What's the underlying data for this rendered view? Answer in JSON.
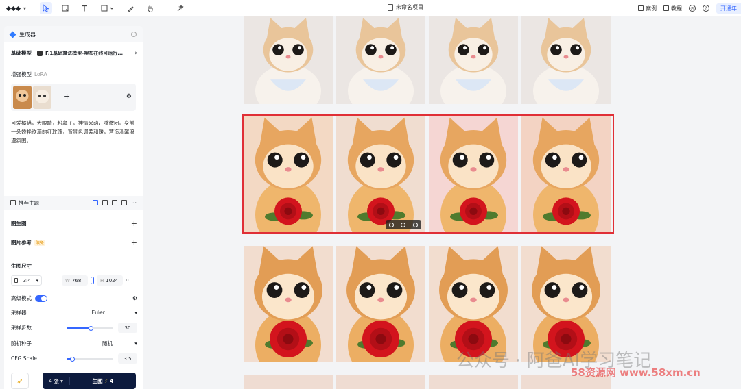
{
  "toolbar": {
    "tools": [
      "select-tool",
      "frame-select-tool",
      "text-tool",
      "shape-tool",
      "pen-tool",
      "hand-tool",
      "magic-tool"
    ],
    "project_title": "未命名项目",
    "cases_label": "案例",
    "tutorial_label": "教程",
    "upgrade_label": "开通年"
  },
  "sidebar": {
    "header_title": "生成器",
    "base_model_label": "基础模型",
    "base_model_value": "F.1基础算法模型-哩布在线可运行...",
    "lora_label": "增强模型",
    "lora_hint": "LoRA",
    "prompt": "可爱橘猫，大眼睛，粉鼻子，神情呆萌，嘴微闭。身前一朵娇艳欲滴的红玫瑰，背景色调柔和暖，营造温馨浪漫氛围。",
    "tab_label": "推荐主题",
    "section_txt2img": "图生图",
    "section_ref": "图片参考",
    "ref_badge": "限免",
    "size_label": "生图尺寸",
    "ratio": "3:4",
    "width_label": "W",
    "width": "768",
    "height_label": "H",
    "height": "1024",
    "advanced_label": "高级模式",
    "sampler_label": "采样器",
    "sampler_value": "Euler",
    "steps_label": "采样步数",
    "steps_value": "30",
    "seed_label": "随机种子",
    "seed_value": "随机",
    "cfg_label": "CFG Scale",
    "cfg_value": "3.5",
    "count_label": "4 张",
    "generate_label": "生图",
    "generate_cost": "4"
  },
  "watermarks": {
    "a": "公众号 · 阿爸AI学习笔记",
    "b": "58资源网  www.58xm.cn"
  }
}
